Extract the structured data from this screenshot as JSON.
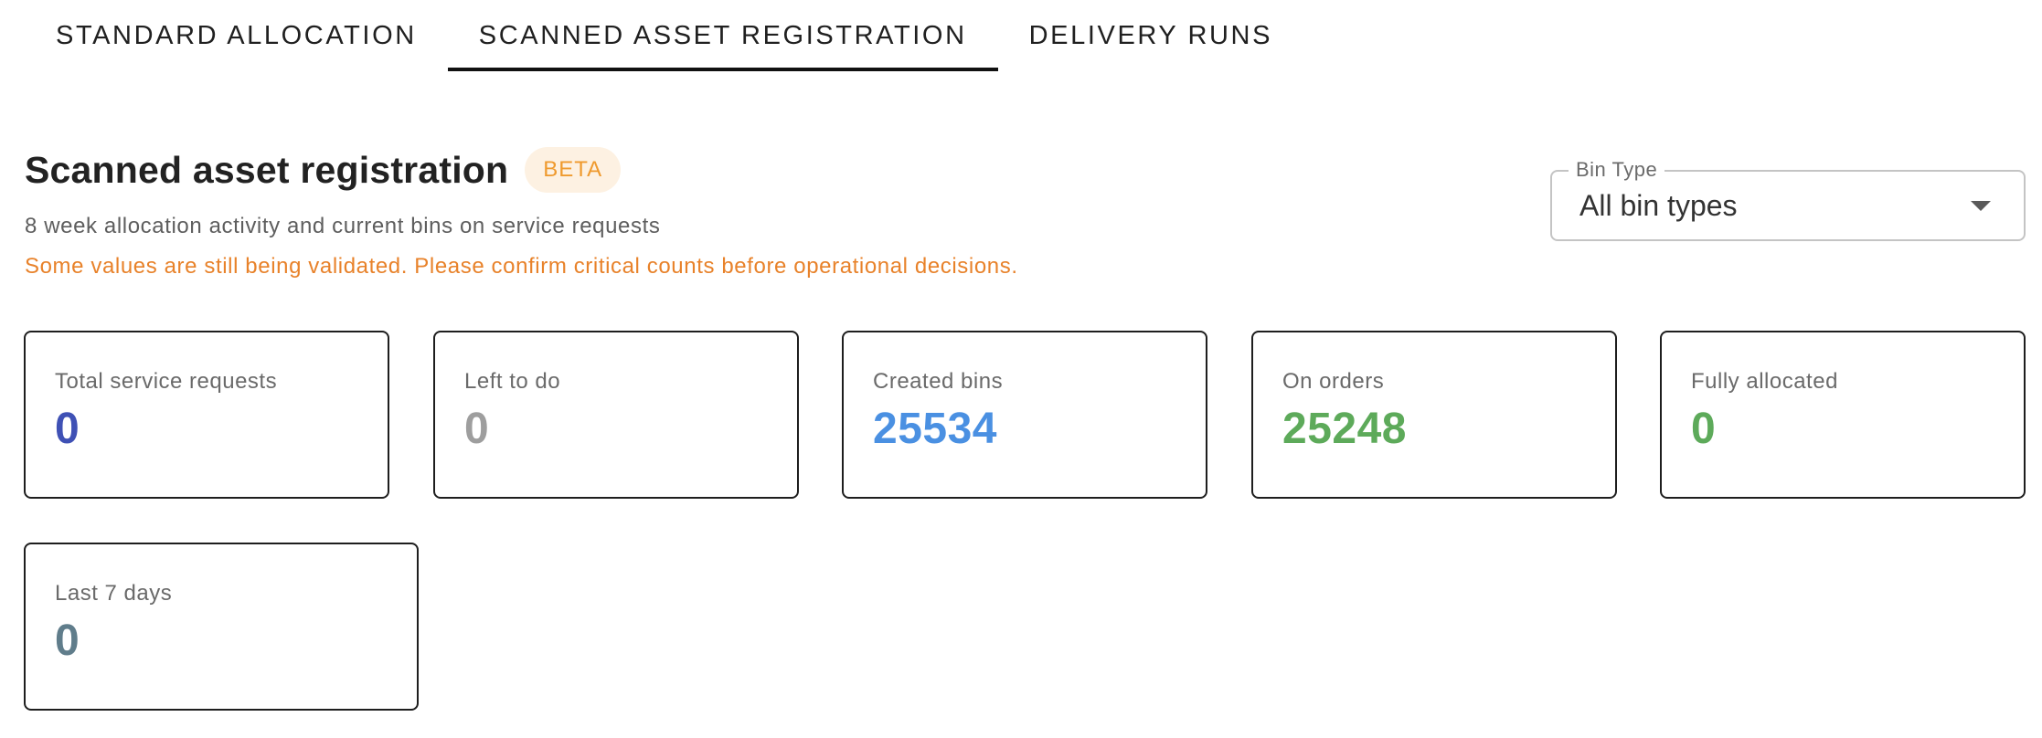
{
  "tabs": [
    {
      "label": "STANDARD ALLOCATION",
      "active": false
    },
    {
      "label": "SCANNED ASSET REGISTRATION",
      "active": true
    },
    {
      "label": "DELIVERY RUNS",
      "active": false
    }
  ],
  "header": {
    "title": "Scanned asset registration",
    "badge": "BETA",
    "subtitle": "8 week allocation activity and current bins on service requests",
    "warning": "Some values are still being validated. Please confirm critical counts before operational decisions."
  },
  "filter": {
    "label": "Bin Type",
    "value": "All bin types",
    "icon": "dropdown-arrow-icon"
  },
  "stats": {
    "total_service_requests": {
      "label": "Total service requests",
      "value": "0",
      "color": "#3f51b5"
    },
    "left_to_do": {
      "label": "Left to do",
      "value": "0",
      "color": "#9e9e9e"
    },
    "created_bins": {
      "label": "Created bins",
      "value": "25534",
      "color": "#4a90e2"
    },
    "on_orders": {
      "label": "On orders",
      "value": "25248",
      "color": "#5daa5a"
    },
    "fully_allocated": {
      "label": "Fully allocated",
      "value": "0",
      "color": "#5daa5a"
    },
    "last_7_days": {
      "label": "Last 7 days",
      "value": "0",
      "color": "#607d8b"
    }
  },
  "colors": {
    "badge_bg": "#fdf1e2",
    "badge_text": "#ef9a2e",
    "warning": "#e8822a"
  }
}
